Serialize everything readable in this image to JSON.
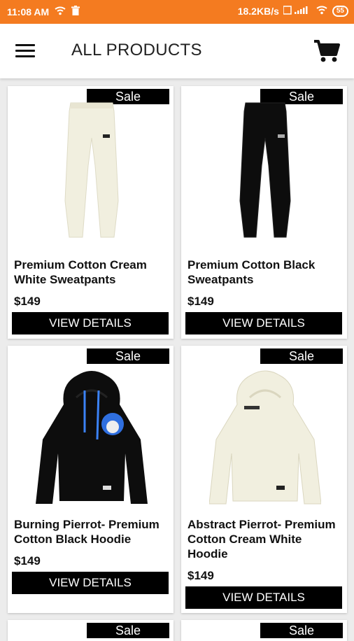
{
  "status_bar": {
    "time": "11:08 AM",
    "speed": "18.2KB/s",
    "battery": "55"
  },
  "app_bar": {
    "title": "ALL PRODUCTS"
  },
  "products": [
    {
      "name": "Premium Cotton Cream White Sweatpants",
      "price": "$149",
      "badge": "Sale",
      "button": "VIEW DETAILS"
    },
    {
      "name": "Premium Cotton Black Sweatpants",
      "price": "$149",
      "badge": "Sale",
      "button": "VIEW DETAILS"
    },
    {
      "name": "Burning Pierrot- Premium Cotton Black Hoodie",
      "price": "$149",
      "badge": "Sale",
      "button": "VIEW DETAILS"
    },
    {
      "name": "Abstract Pierrot- Premium Cotton Cream White Hoodie",
      "price": "$149",
      "badge": "Sale",
      "button": "VIEW DETAILS"
    },
    {
      "badge": "Sale"
    },
    {
      "badge": "Sale"
    }
  ],
  "colors": {
    "status_bar": "#f47b20",
    "button": "#000000",
    "cream": "#f1efdf"
  }
}
